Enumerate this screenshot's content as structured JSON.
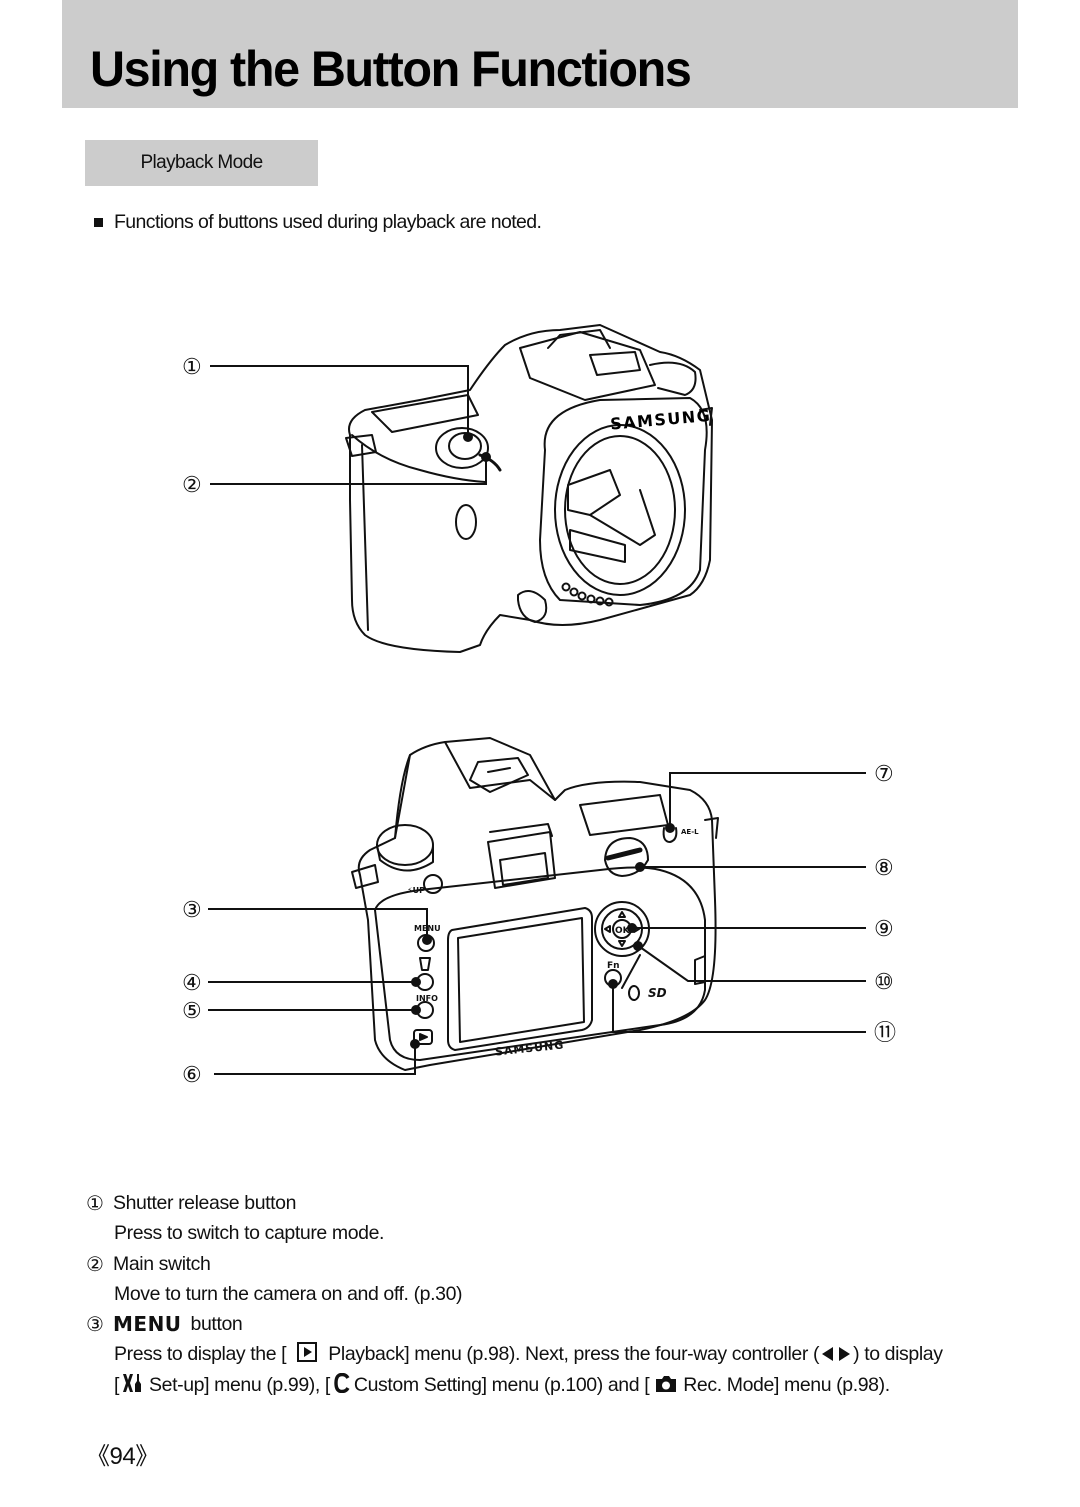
{
  "header": {
    "title": "Using the Button Functions"
  },
  "section": {
    "label": "Playback Mode"
  },
  "intro": {
    "text": "Functions of buttons used during playback are noted."
  },
  "front_diagram": {
    "brand": "SAMSUNG",
    "callouts": [
      {
        "num": "①",
        "target": "shutter-release-button"
      },
      {
        "num": "②",
        "target": "main-switch"
      }
    ]
  },
  "back_diagram": {
    "brand": "SAMSUNG",
    "labels": {
      "menu": "MENU",
      "info": "INFO",
      "fn": "Fn",
      "ok": "OK",
      "ael": "AE-L",
      "flash_up": "⚡UP",
      "sd": "SD"
    },
    "callouts": [
      {
        "num": "③",
        "target": "menu-button"
      },
      {
        "num": "④",
        "target": "delete-button"
      },
      {
        "num": "⑤",
        "target": "info-button"
      },
      {
        "num": "⑥",
        "target": "playback-button"
      },
      {
        "num": "⑦",
        "target": "ae-l-button"
      },
      {
        "num": "⑧",
        "target": "zoom-dial"
      },
      {
        "num": "⑨",
        "target": "ok-button"
      },
      {
        "num": "⑩",
        "target": "four-way-controller"
      },
      {
        "num": "⑪",
        "target": "fn-button"
      }
    ]
  },
  "descriptions": [
    {
      "num": "①",
      "title": "Shutter release button",
      "body": "Press to switch to capture mode."
    },
    {
      "num": "②",
      "title": "Main switch",
      "body": "Move to turn the camera on and off. (p.30)"
    },
    {
      "num": "③",
      "title_bold": "MENU",
      "title": "button",
      "line1": {
        "a": "Press to display the [",
        "b": "Playback] menu (p.98). Next, press the four-way controller (",
        "c": ") to display"
      },
      "line2": {
        "a": "[",
        "b": "Set-up] menu (p.99), [",
        "c": "Custom Setting] menu (p.100) and [",
        "d": "Rec. Mode] menu (p.98)."
      }
    }
  ],
  "icons": {
    "playback": "playback-icon",
    "arrows": "left-right-arrows-icon",
    "setup": "wrench-setup-icon",
    "custom": "custom-setting-c-icon",
    "rec": "camera-rec-icon"
  },
  "footer": {
    "page": "《94》"
  },
  "colors": {
    "band": "#cccccc",
    "text": "#111111"
  }
}
